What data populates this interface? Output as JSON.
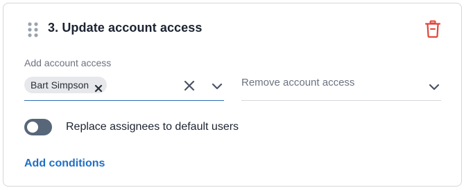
{
  "step": {
    "title": "3. Update account access"
  },
  "add_access": {
    "label": "Add account access",
    "selected": [
      "Bart Simpson"
    ]
  },
  "remove_access": {
    "placeholder": "Remove account access"
  },
  "replace_toggle": {
    "label": "Replace assignees to default users",
    "enabled": false
  },
  "add_conditions_label": "Add conditions",
  "icons": {
    "drag": "drag-handle-icon",
    "delete": "trash-icon",
    "chip_remove": "close-icon",
    "clear": "close-icon",
    "expand": "chevron-down-icon"
  },
  "colors": {
    "accent": "#1f6fc5",
    "danger": "#e0453a",
    "toggle_off": "#58667a",
    "active_underline": "#2f6cb3"
  }
}
